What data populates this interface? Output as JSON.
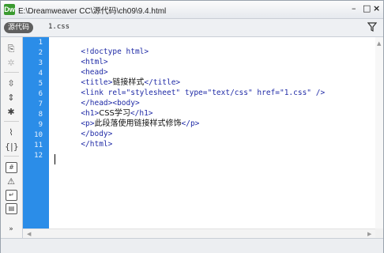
{
  "window": {
    "title": "E:\\Dreamweaver CC\\源代码\\ch09\\9.4.html",
    "app_icon_label": "Dw",
    "minimize_label": "–",
    "maximize_label": "□",
    "close_label": "×"
  },
  "tabs": {
    "source_label": "源代码",
    "related_file": "1.css"
  },
  "gutter": {
    "line_numbers": [
      "1",
      "2",
      "3",
      "4",
      "5",
      "6",
      "7",
      "8",
      "9",
      "10",
      "11",
      "12"
    ]
  },
  "code": {
    "lines": [
      {
        "t1": "<!doctype html>"
      },
      {
        "t1": "<html>"
      },
      {
        "t1": "<head>"
      },
      {
        "t1": "<title>",
        "t2": "链接样式",
        "t3": "</title>"
      },
      {
        "t1": "<link rel=\"stylesheet\" type=\"text/css\" href=\"1.css\" />"
      },
      {
        "t1": "</head><body>"
      },
      {
        "t1": "<h1>",
        "t2": "CSS学习",
        "t3": "</h1>"
      },
      {
        "t1": "<p>",
        "t2": "此段落使用链接样式修饰",
        "t3": "</p>"
      },
      {
        "t1": "</body>"
      },
      {
        "t1": "</html>"
      }
    ]
  },
  "toolbar": {
    "icons": [
      "open-documents-icon",
      "collapse-full-tag-icon",
      "collapse-selection-icon",
      "expand-all-icon",
      "select-parent-tag-icon",
      "balance-braces-icon",
      "line-numbers-icon",
      "highlight-invalid-code-icon",
      "apply-comment-icon",
      "remove-comment-icon",
      "wrap-tag-icon",
      "recent-snippets-icon",
      "move-css-icon",
      "indent-icon"
    ]
  },
  "colors": {
    "gutter": "#2b8de8",
    "tag": "#1f2aa6",
    "source_tab_bg": "#5f5f5f"
  }
}
